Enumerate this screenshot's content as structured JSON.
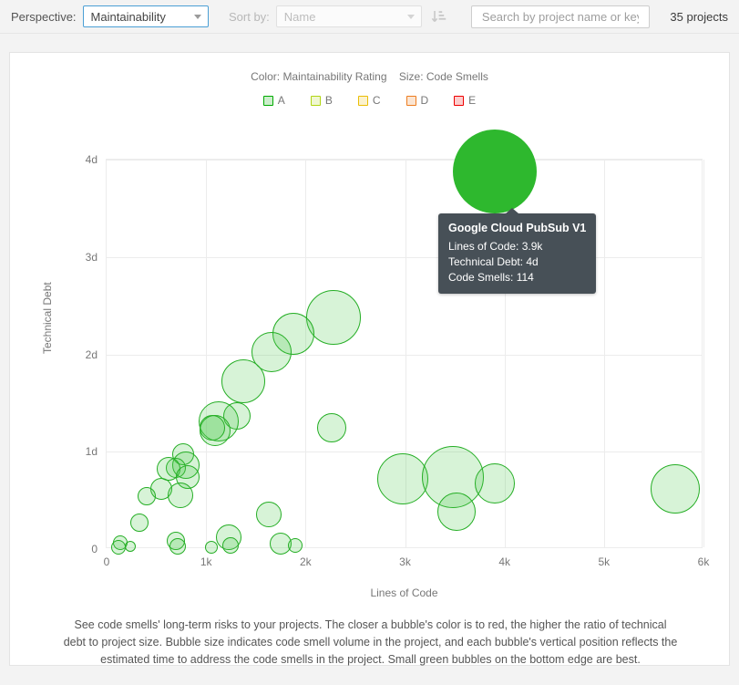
{
  "toolbar": {
    "perspective_label": "Perspective:",
    "perspective_value": "Maintainability",
    "sort_label": "Sort by:",
    "sort_value": "Name",
    "sort_direction_icon": "sort-descending-icon",
    "search_placeholder": "Search by project name or key",
    "search_value": "",
    "project_count": "35 projects"
  },
  "chart_header": {
    "color_legend": "Color: Maintainability Rating",
    "size_legend": "Size: Code Smells"
  },
  "legend": [
    {
      "label": "A",
      "color": "#00aa00"
    },
    {
      "label": "B",
      "color": "#b0d513"
    },
    {
      "label": "C",
      "color": "#eabe06"
    },
    {
      "label": "D",
      "color": "#ed7d20"
    },
    {
      "label": "E",
      "color": "#ee0000"
    }
  ],
  "tooltip": {
    "title": "Google Cloud PubSub V1",
    "line1": "Lines of Code: 3.9k",
    "line2": "Technical Debt: 4d",
    "line3": "Code Smells: 114"
  },
  "footer_note": "See code smells' long-term risks to your projects. The closer a bubble's color is to red, the higher the ratio of technical debt to project size. Bubble size indicates code smell volume in the project, and each bubble's vertical position reflects the estimated time to address the code smells in the project. Small green bubbles on the bottom edge are best.",
  "chart_data": {
    "type": "scatter",
    "title": "",
    "xlabel": "Lines of Code",
    "ylabel": "Technical Debt",
    "xticks": [
      "0",
      "1k",
      "2k",
      "3k",
      "4k",
      "5k",
      "6k"
    ],
    "xtick_values": [
      0,
      1000,
      2000,
      3000,
      4000,
      5000,
      6000
    ],
    "yticks": [
      "0",
      "1d",
      "2d",
      "3d",
      "4d"
    ],
    "ytick_values": [
      0,
      1,
      2,
      3,
      4
    ],
    "xlim": [
      0,
      6000
    ],
    "ylim": [
      0,
      4
    ],
    "grid": true,
    "legend_position": "top",
    "size_metric": "Code Smells",
    "color_metric": "Maintainability Rating",
    "points": [
      {
        "x": 3900,
        "y": 3.88,
        "r": 46,
        "rating": "A",
        "active": true,
        "name": "Google Cloud PubSub V1",
        "lines_of_code": "3.9k",
        "technical_debt": "4d",
        "code_smells": 114
      },
      {
        "x": 2280,
        "y": 2.38,
        "r": 30,
        "rating": "A"
      },
      {
        "x": 1880,
        "y": 2.21,
        "r": 23,
        "rating": "A"
      },
      {
        "x": 1660,
        "y": 2.02,
        "r": 22,
        "rating": "A"
      },
      {
        "x": 1375,
        "y": 1.72,
        "r": 24,
        "rating": "A"
      },
      {
        "x": 1310,
        "y": 1.37,
        "r": 15,
        "rating": "A"
      },
      {
        "x": 1130,
        "y": 1.31,
        "r": 22,
        "rating": "A"
      },
      {
        "x": 1090,
        "y": 1.22,
        "r": 17,
        "rating": "A"
      },
      {
        "x": 1060,
        "y": 1.25,
        "r": 14,
        "rating": "A"
      },
      {
        "x": 2260,
        "y": 1.25,
        "r": 16,
        "rating": "A"
      },
      {
        "x": 770,
        "y": 0.97,
        "r": 12,
        "rating": "A"
      },
      {
        "x": 800,
        "y": 0.86,
        "r": 15,
        "rating": "A"
      },
      {
        "x": 700,
        "y": 0.83,
        "r": 11,
        "rating": "A"
      },
      {
        "x": 620,
        "y": 0.82,
        "r": 13,
        "rating": "A"
      },
      {
        "x": 815,
        "y": 0.74,
        "r": 13,
        "rating": "A"
      },
      {
        "x": 550,
        "y": 0.62,
        "r": 12,
        "rating": "A"
      },
      {
        "x": 740,
        "y": 0.55,
        "r": 14,
        "rating": "A"
      },
      {
        "x": 400,
        "y": 0.54,
        "r": 10,
        "rating": "A"
      },
      {
        "x": 2980,
        "y": 0.72,
        "r": 28,
        "rating": "A"
      },
      {
        "x": 3480,
        "y": 0.74,
        "r": 34,
        "rating": "A"
      },
      {
        "x": 3900,
        "y": 0.67,
        "r": 22,
        "rating": "A"
      },
      {
        "x": 5720,
        "y": 0.62,
        "r": 27,
        "rating": "A"
      },
      {
        "x": 3520,
        "y": 0.38,
        "r": 21,
        "rating": "A"
      },
      {
        "x": 1630,
        "y": 0.36,
        "r": 14,
        "rating": "A"
      },
      {
        "x": 330,
        "y": 0.27,
        "r": 10,
        "rating": "A"
      },
      {
        "x": 1230,
        "y": 0.12,
        "r": 14,
        "rating": "A"
      },
      {
        "x": 1250,
        "y": 0.04,
        "r": 9,
        "rating": "A"
      },
      {
        "x": 1750,
        "y": 0.06,
        "r": 12,
        "rating": "A"
      },
      {
        "x": 1900,
        "y": 0.04,
        "r": 8,
        "rating": "A"
      },
      {
        "x": 700,
        "y": 0.08,
        "r": 10,
        "rating": "A"
      },
      {
        "x": 710,
        "y": 0.03,
        "r": 9,
        "rating": "A"
      },
      {
        "x": 140,
        "y": 0.07,
        "r": 8,
        "rating": "A"
      },
      {
        "x": 120,
        "y": 0.02,
        "r": 8,
        "rating": "A"
      },
      {
        "x": 240,
        "y": 0.03,
        "r": 6,
        "rating": "A"
      },
      {
        "x": 1050,
        "y": 0.02,
        "r": 7,
        "rating": "A"
      }
    ]
  }
}
